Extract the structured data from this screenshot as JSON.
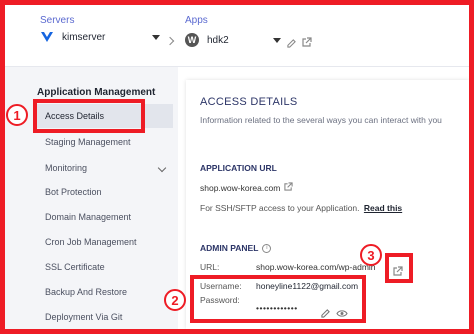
{
  "topbar": {
    "servers_label": "Servers",
    "server_name": "kimserver",
    "apps_label": "Apps",
    "app_name": "hdk2"
  },
  "sidebar": {
    "title": "Application Management",
    "items": [
      {
        "label": "Access Details"
      },
      {
        "label": "Staging Management"
      },
      {
        "label": "Monitoring"
      },
      {
        "label": "Bot Protection"
      },
      {
        "label": "Domain Management"
      },
      {
        "label": "Cron Job Management"
      },
      {
        "label": "SSL Certificate"
      },
      {
        "label": "Backup And Restore"
      },
      {
        "label": "Deployment Via Git"
      }
    ]
  },
  "main": {
    "title": "ACCESS DETAILS",
    "description": "Information related to the several ways you can interact with you",
    "app_url_heading": "APPLICATION URL",
    "app_url": "shop.wow-korea.com",
    "sftp_note": "For SSH/SFTP access to your Application.",
    "read_this": "Read this",
    "admin_heading": "ADMIN PANEL",
    "url_label": "URL:",
    "admin_url": "shop.wow-korea.com/wp-admin",
    "username_label": "Username:",
    "username": "honeyline1122@gmail.com",
    "password_label": "Password:",
    "password_mask": "••••••••••••"
  },
  "annotations": {
    "marker_1": "1",
    "marker_2": "2",
    "marker_3": "3"
  },
  "colors": {
    "annotation_red": "#ee1c25",
    "accent_blue": "#5b6ad0",
    "heading_navy": "#2c3567"
  }
}
